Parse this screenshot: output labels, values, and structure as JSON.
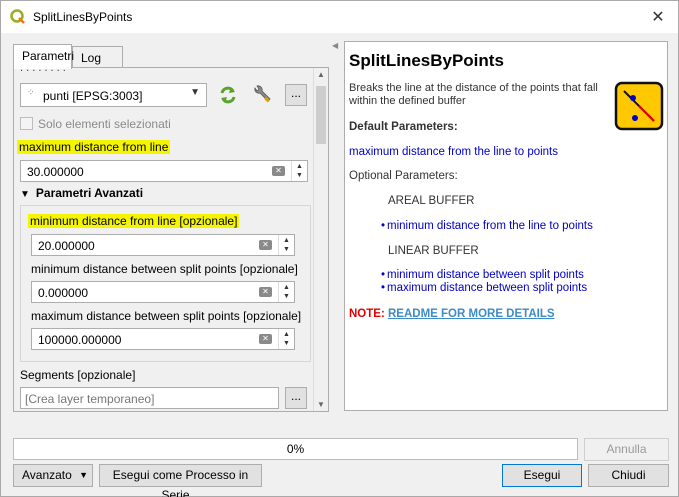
{
  "window": {
    "title": "SplitLinesByPoints"
  },
  "tabs": [
    {
      "label": "Parametri"
    },
    {
      "label": "Log"
    }
  ],
  "form": {
    "layer_combo_value": "punti [EPSG:3003]",
    "layer_more_label": "...",
    "selected_only_label": "Solo elementi selezionati",
    "max_distance_label": "maximum distance from line",
    "max_distance_value": "30.000000",
    "advanced_group_label": "Parametri Avanzati",
    "min_distance_label": "minimum distance from line [opzionale]",
    "min_distance_value": "20.000000",
    "min_split_label": "minimum distance between split points [opzionale]",
    "min_split_value": "0.000000",
    "max_split_label": "maximum distance between split points [opzionale]",
    "max_split_value": "100000.000000",
    "segments_label": "Segments [opzionale]",
    "segments_placeholder": "[Crea layer temporaneo]",
    "segments_more_label": "..."
  },
  "help": {
    "title": "SplitLinesByPoints",
    "description": "Breaks the line at the distance of the points that fall within the defined buffer",
    "default_params_heading": "Default Parameters:",
    "default_param": "maximum distance from the line to points",
    "optional_heading": "Optional Parameters:",
    "areal_buffer": "AREAL BUFFER",
    "areal_item": "minimum distance from the line to points",
    "linear_buffer": "LINEAR BUFFER",
    "linear_items": [
      "minimum distance between split points",
      "maximum distance between split points"
    ],
    "note_label": "NOTE:",
    "readme_link": "README FOR MORE DETAILS"
  },
  "progress": {
    "percent_label": "0%",
    "fraction": 0
  },
  "buttons": {
    "cancel": "Annulla",
    "advanced": "Avanzato",
    "batch": "Esegui come Processo in Serie...",
    "run": "Esegui",
    "close": "Chiudi"
  },
  "colors": {
    "highlight": "#f5f500",
    "help_blue": "#0000c8",
    "note_red": "#e00000",
    "link_blue": "#3d8bc4"
  }
}
